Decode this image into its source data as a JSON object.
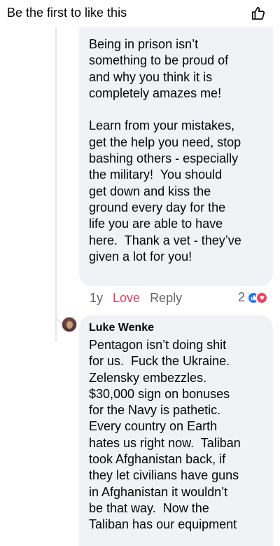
{
  "header": {
    "title": "Be the first to like this",
    "like_icon": "thumbs-up-outline-icon"
  },
  "comment1": {
    "text": "Being in prison isn’t\nsomething to be proud of\nand why you think it is\ncompletely amazes me!\n\nLearn from your mistakes,\nget the help you need, stop\nbashing others - especially\nthe military!  You should\nget down and kiss the\nground every day for the\nlife you are able to have\nhere.  Thank a vet - they’ve\ngiven a lot for you!",
    "time": "1y",
    "reaction_label": "Love",
    "reply_label": "Reply",
    "reaction_count": "2",
    "reactions": [
      "like",
      "love"
    ],
    "colors": {
      "love": "#e4405f",
      "like_badge": "#1877f2",
      "love_badge": "#f33e58"
    }
  },
  "comment2": {
    "author": "Luke Wenke",
    "text": "Pentagon isn’t doing shit\nfor us.  Fuck the Ukraine.\nZelensky embezzles.\n$30,000 sign on bonuses\nfor the Navy is pathetic.\nEvery country on Earth\nhates us right now.  Taliban\ntook Afghanistan back, if\nthey let civilians have guns\nin Afghanistan it wouldn’t\nbe that way.  Now the\nTaliban has our equipment"
  },
  "colors": {
    "bubble_bg": "#f0f2f5",
    "text": "#050505",
    "secondary_text": "#65676b"
  }
}
